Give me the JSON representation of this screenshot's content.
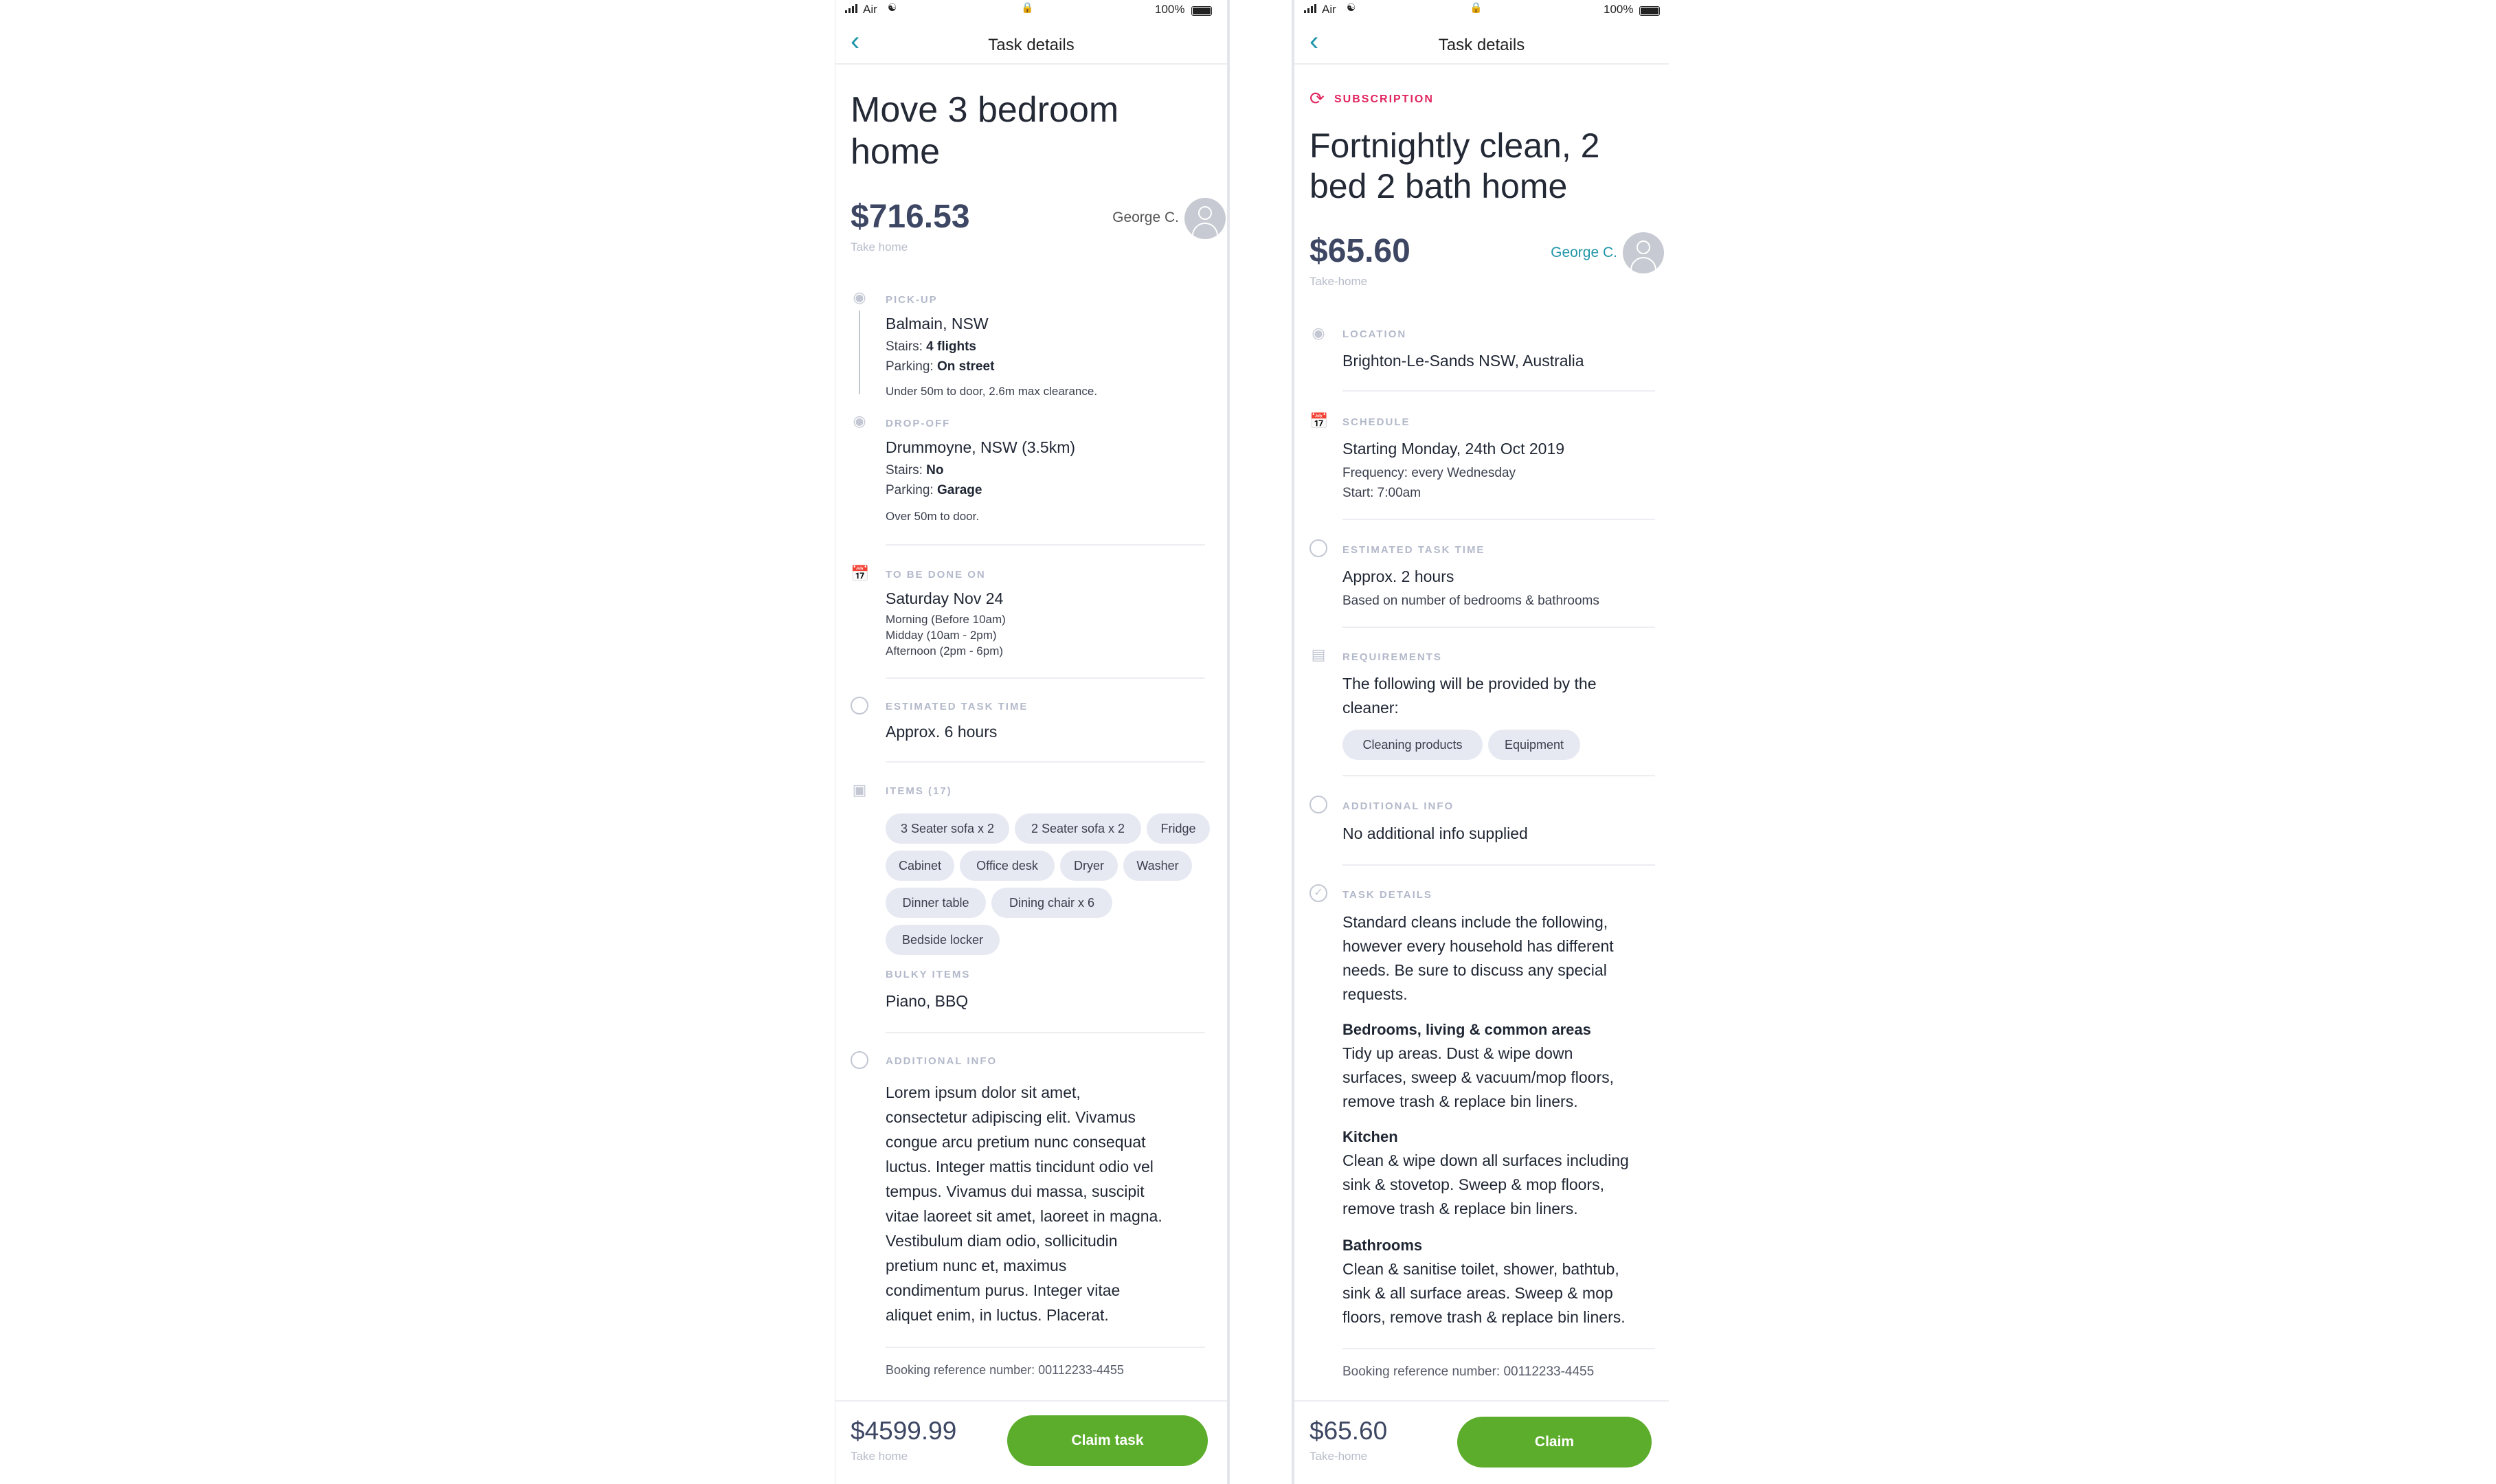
{
  "status_bar": {
    "carrier": "Air",
    "battery": "100%"
  },
  "nav": {
    "title": "Task details"
  },
  "colors": {
    "accent": "#2196a8",
    "claim_green": "#5cad2c",
    "subscription": "#e0245e",
    "price": "#3d4763"
  },
  "left": {
    "title_line1": "Move 3 bedroom",
    "title_line2": "home",
    "price": "$716.53",
    "take_home": "Take home",
    "poster": "George C.",
    "pickup": {
      "label": "PICK-UP",
      "place": "Balmain, NSW",
      "stairs_label": "Stairs:",
      "stairs": "4 flights",
      "parking_label": "Parking:",
      "parking": "On street",
      "note": "Under 50m to door, 2.6m max clearance."
    },
    "dropoff": {
      "label": "DROP-OFF",
      "place": "Drummoyne, NSW (3.5km)",
      "stairs_label": "Stairs:",
      "stairs": "No",
      "parking_label": "Parking:",
      "parking": "Garage",
      "note": "Over 50m to door."
    },
    "date": {
      "label": "TO BE DONE ON",
      "value": "Saturday Nov 24",
      "slots": [
        "Morning (Before 10am)",
        "Midday (10am - 2pm)",
        "Afternoon (2pm - 6pm)"
      ]
    },
    "time": {
      "label": "ESTIMATED TASK TIME",
      "value": "Approx. 6 hours"
    },
    "items": {
      "label": "ITEMS (17)",
      "chips": [
        "3 Seater sofa x 2",
        "2 Seater sofa x 2",
        "Fridge",
        "Cabinet",
        "Office desk",
        "Dryer",
        "Washer",
        "Dinner table",
        "Dining chair x 6",
        "Bedside locker"
      ],
      "bulky_label": "BULKY ITEMS",
      "bulky": "Piano, BBQ"
    },
    "info": {
      "label": "ADDITIONAL INFO",
      "lines": [
        "Lorem ipsum dolor sit amet,",
        "consectetur adipiscing elit. Vivamus",
        "congue arcu pretium nunc consequat",
        "luctus. Integer mattis tincidunt odio vel",
        "tempus. Vivamus dui massa, suscipit",
        "vitae laoreet sit amet, laoreet in magna.",
        "Vestibulum diam odio, sollicitudin",
        "pretium nunc et, maximus",
        "condimentum purus. Integer vitae",
        "aliquet enim, in luctus. Placerat."
      ]
    },
    "ref": "Booking reference number: 00112233-4455",
    "footer": {
      "price": "$4599.99",
      "take_home": "Take home",
      "button": "Claim task"
    }
  },
  "right": {
    "badge": "SUBSCRIPTION",
    "title_line1": "Fortnightly clean, 2",
    "title_line2": "bed 2 bath home",
    "price": "$65.60",
    "take_home": "Take-home",
    "poster": "George C.",
    "location": {
      "label": "LOCATION",
      "value": "Brighton-Le-Sands NSW, Australia"
    },
    "schedule": {
      "label": "SCHEDULE",
      "value": "Starting Monday, 24th Oct 2019",
      "frequency": "Frequency: every Wednesday",
      "start": "Start: 7:00am"
    },
    "time": {
      "label": "ESTIMATED TASK TIME",
      "value": "Approx. 2 hours",
      "note": "Based on number of bedrooms & bathrooms"
    },
    "requirements": {
      "label": "REQUIREMENTS",
      "line1": "The following will be provided by the",
      "line2": "cleaner:",
      "chips": [
        "Cleaning products",
        "Equipment"
      ]
    },
    "info": {
      "label": "ADDITIONAL INFO",
      "value": "No additional info supplied"
    },
    "details": {
      "label": "TASK DETAILS",
      "intro": [
        "Standard cleans include the following,",
        "however every household has different",
        "needs. Be sure to discuss any special",
        "requests."
      ],
      "sections": [
        {
          "heading": "Bedrooms, living & common areas",
          "lines": [
            "Tidy up areas. Dust & wipe down",
            "surfaces, sweep & vacuum/mop floors,",
            "remove trash & replace bin liners."
          ]
        },
        {
          "heading": "Kitchen",
          "lines": [
            "Clean & wipe down all surfaces including",
            "sink & stovetop. Sweep & mop floors,",
            "remove trash & replace bin liners."
          ]
        },
        {
          "heading": "Bathrooms",
          "lines": [
            "Clean & sanitise toilet, shower, bathtub,",
            "sink & all surface areas. Sweep & mop",
            "floors, remove trash & replace bin liners."
          ]
        }
      ]
    },
    "ref": "Booking reference number: 00112233-4455",
    "footer": {
      "price": "$65.60",
      "take_home": "Take-home",
      "button": "Claim"
    }
  }
}
